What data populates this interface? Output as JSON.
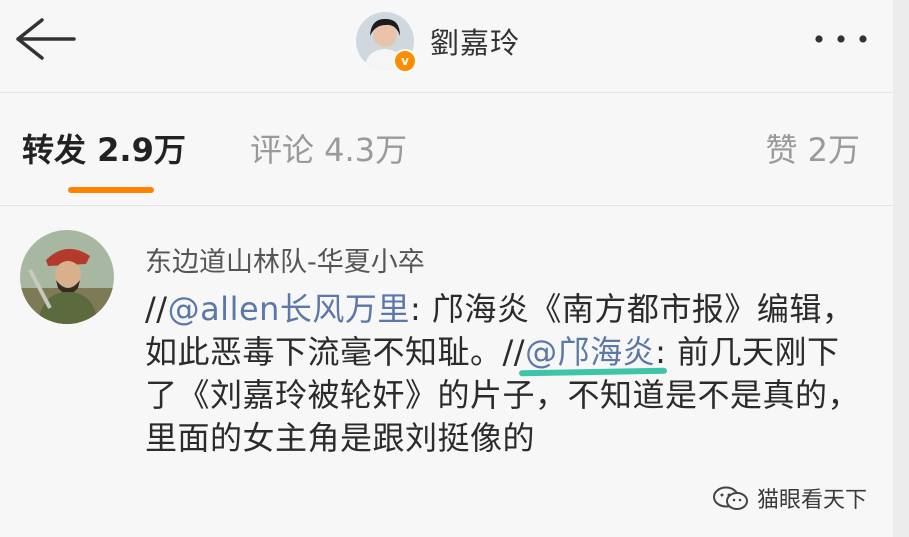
{
  "header": {
    "back_icon": "back-arrow-icon",
    "profile_name": "劉嘉玲",
    "verified_color": "#ff8c00",
    "more_icon": "more-dots-icon"
  },
  "tabs": {
    "repost": "转发 2.9万",
    "comment": "评论 4.3万",
    "like": "赞 2万",
    "active": "repost",
    "accent_color": "#ff8200"
  },
  "post": {
    "username": "东边道山林队-华夏小卒",
    "segments": {
      "s1": "//",
      "m1": "@allen长风万里",
      "s2": ": 邝海炎《南方都市报》编辑，如此恶毒下流毫不知耻。//",
      "m2": "@邝海炎",
      "s3": ": 前几天刚下了《刘嘉玲被轮奸》的片子，不知道是不是真的，里面的女主角是跟刘挺像的"
    },
    "mention_color": "#5b78a8",
    "highlight_color": "#3ec4a6"
  },
  "watermark": {
    "text": "猫眼看天下",
    "icon": "wechat-icon"
  }
}
